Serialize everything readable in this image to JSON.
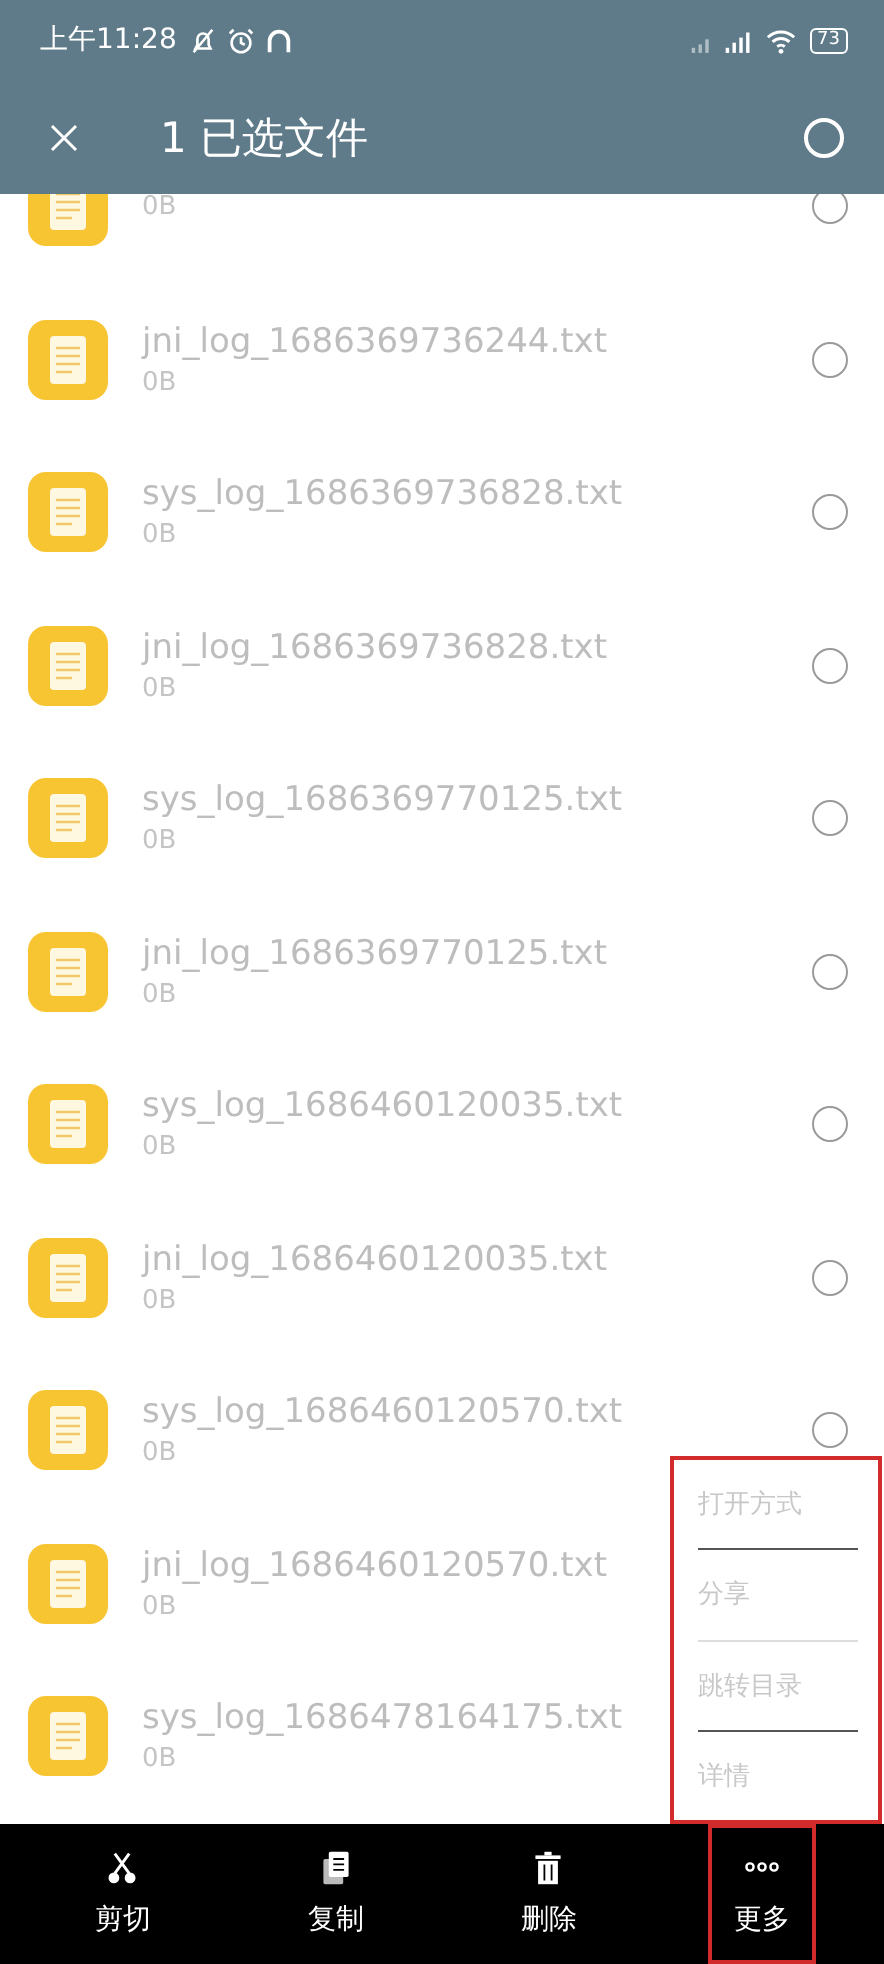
{
  "status_bar": {
    "time": "上午11:28",
    "battery": "73"
  },
  "header": {
    "title": "1 已选文件",
    "all_selected": false
  },
  "files": [
    {
      "size": "0B",
      "selected": false
    },
    {
      "name": "jni_log_1686369736244.txt",
      "size": "0B",
      "selected": false
    },
    {
      "name": "sys_log_1686369736828.txt",
      "size": "0B",
      "selected": false
    },
    {
      "name": "jni_log_1686369736828.txt",
      "size": "0B",
      "selected": false
    },
    {
      "name": "sys_log_1686369770125.txt",
      "size": "0B",
      "selected": false
    },
    {
      "name": "jni_log_1686369770125.txt",
      "size": "0B",
      "selected": false
    },
    {
      "name": "sys_log_1686460120035.txt",
      "size": "0B",
      "selected": false
    },
    {
      "name": "jni_log_1686460120035.txt",
      "size": "0B",
      "selected": false
    },
    {
      "name": "sys_log_1686460120570.txt",
      "size": "0B",
      "selected": false
    },
    {
      "name": "jni_log_1686460120570.txt",
      "size": "0B"
    },
    {
      "name": "sys_log_1686478164175.txt",
      "size": "0B"
    }
  ],
  "more_menu": {
    "highlighted": true,
    "items": [
      {
        "label": "打开方式",
        "disabled": true
      },
      {
        "label": "分享",
        "disabled": true
      },
      {
        "label": "跳转目录",
        "disabled": true
      },
      {
        "label": "详情",
        "disabled": true
      }
    ]
  },
  "toolbar": [
    {
      "kind": "cut",
      "label": "剪切",
      "highlighted": false
    },
    {
      "kind": "copy",
      "label": "复制",
      "highlighted": false
    },
    {
      "kind": "delete",
      "label": "删除",
      "highlighted": false
    },
    {
      "kind": "more",
      "label": "更多",
      "highlighted": true
    }
  ]
}
